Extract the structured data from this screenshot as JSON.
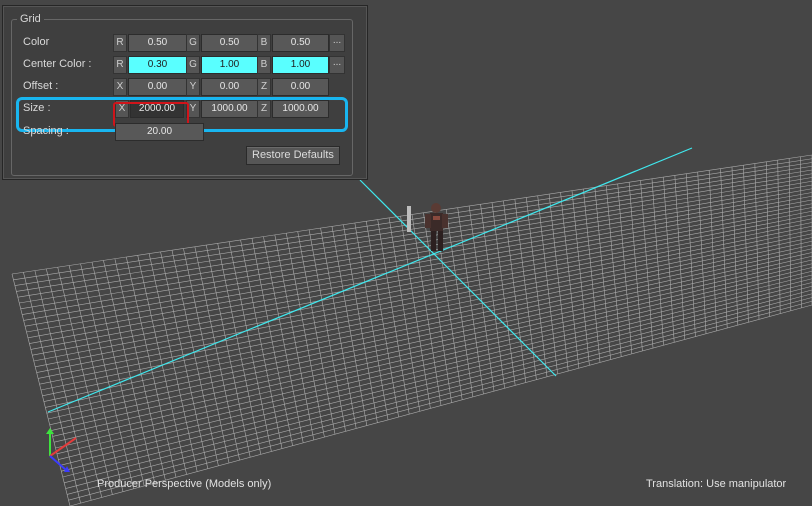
{
  "panel": {
    "group_title": "Grid",
    "rows": {
      "color": {
        "label": "Color",
        "ch": [
          "R",
          "G",
          "B"
        ],
        "values": [
          "0.50",
          "0.50",
          "0.50"
        ]
      },
      "center": {
        "label": "Center Color :",
        "ch": [
          "R",
          "G",
          "B"
        ],
        "values": [
          "0.30",
          "1.00",
          "1.00"
        ]
      },
      "offset": {
        "label": "Offset :",
        "ch": [
          "X",
          "Y",
          "Z"
        ],
        "values": [
          "0.00",
          "0.00",
          "0.00"
        ]
      },
      "size": {
        "label": "Size :",
        "ch": [
          "X",
          "Y",
          "Z"
        ],
        "values": [
          "2000.00",
          "1000.00",
          "1000.00"
        ]
      },
      "spacing": {
        "label": "Spacing :",
        "value": "20.00"
      }
    },
    "dots_label": "...",
    "restore_button": "Restore Defaults"
  },
  "viewport": {
    "camera_label": "Producer Perspective (Models only)",
    "status_label": "Translation: Use manipulator",
    "background": "#464646",
    "grid_line_color": "#cfcfcf",
    "center_line_color": "#3fe8ee",
    "highlight_blue": "#19b6f0",
    "highlight_red": "#d0141a"
  }
}
